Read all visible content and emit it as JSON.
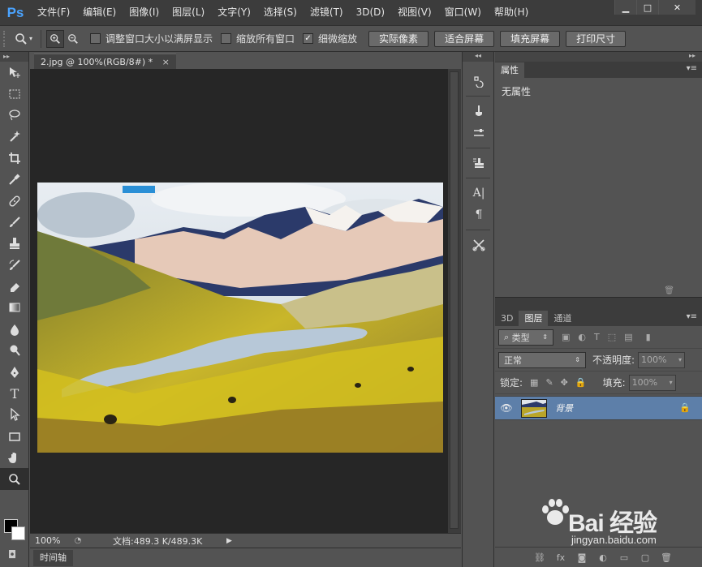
{
  "app": {
    "logo": "Ps"
  },
  "menu": [
    "文件(F)",
    "编辑(E)",
    "图像(I)",
    "图层(L)",
    "文字(Y)",
    "选择(S)",
    "滤镜(T)",
    "3D(D)",
    "视图(V)",
    "窗口(W)",
    "帮助(H)"
  ],
  "window_controls": {
    "minimize": "▁",
    "maximize": "□",
    "close": "✕"
  },
  "options": {
    "checkbox_resize": {
      "label": "调整窗口大小以满屏显示",
      "checked": false
    },
    "checkbox_zoom_all": {
      "label": "缩放所有窗口",
      "checked": false
    },
    "checkbox_scrubby": {
      "label": "细微缩放",
      "checked": true
    },
    "buttons": {
      "actual_pixels": "实际像素",
      "fit_screen": "适合屏幕",
      "fill_screen": "填充屏幕",
      "print_size": "打印尺寸"
    }
  },
  "document": {
    "tab_title": "2.jpg @ 100%(RGB/8#) *",
    "tab_close": "×",
    "zoom": "100%",
    "doc_info": "文档:489.3 K/489.3K"
  },
  "timeline_tab": "时间轴",
  "properties_panel": {
    "tab": "属性",
    "empty_text": "无属性"
  },
  "layers_panel": {
    "tabs": [
      "3D",
      "图层",
      "通道"
    ],
    "filter_kind": "类型",
    "blend_mode": "正常",
    "opacity_label": "不透明度:",
    "opacity_value": "100%",
    "lock_label": "锁定:",
    "fill_label": "填充:",
    "fill_value": "100%",
    "layers": [
      {
        "name": "背景",
        "visible": true,
        "locked": true
      }
    ]
  },
  "watermark": {
    "text": "Bai 经验",
    "url": "jingyan.baidu.com"
  },
  "colors": {
    "selected_layer": "#5d7fa9",
    "logo_blue": "#4aa3ff",
    "foreground_color": "#000000",
    "background_color": "#ffffff"
  }
}
